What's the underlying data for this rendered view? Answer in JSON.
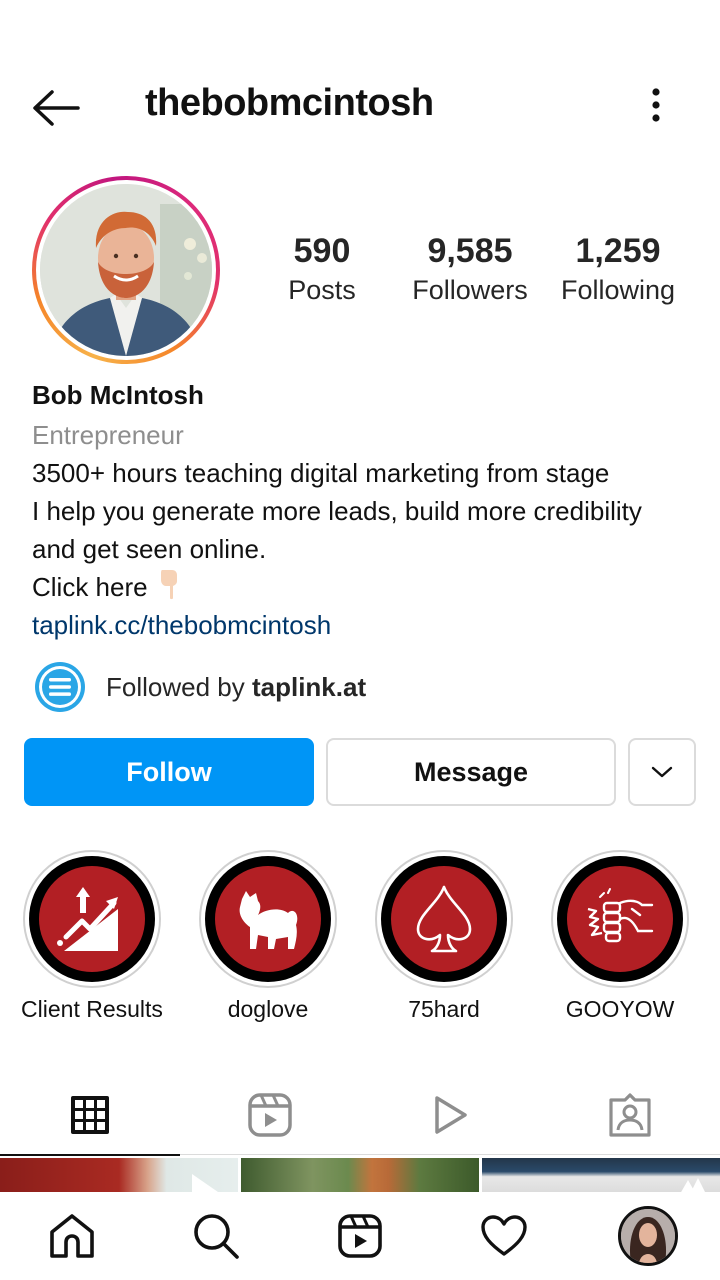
{
  "header": {
    "username": "thebobmcintosh",
    "back_icon": "arrow-left-icon",
    "more_icon": "more-vertical-icon"
  },
  "profile": {
    "avatar_alt": "Profile photo of Bob McIntosh",
    "stats": [
      {
        "value": "590",
        "label": "Posts"
      },
      {
        "value": "9,585",
        "label": "Followers"
      },
      {
        "value": "1,259",
        "label": "Following"
      }
    ],
    "name": "Bob McIntosh",
    "category": "Entrepreneur",
    "bio_lines": [
      "3500+ hours teaching digital marketing from stage",
      "I help you generate more leads, build more credibility",
      "and get seen online.",
      "Click here"
    ],
    "link": "taplink.cc/thebobmcintosh",
    "followed_by_prefix": "Followed by ",
    "followed_by_account": "taplink.at"
  },
  "actions": {
    "follow": "Follow",
    "message": "Message",
    "more_icon": "chevron-down-icon"
  },
  "highlights": [
    {
      "label": "Client Results",
      "icon": "growth-chart-icon"
    },
    {
      "label": "doglove",
      "icon": "dog-icon"
    },
    {
      "label": "75hard",
      "icon": "spade-icon"
    },
    {
      "label": "GOOYOW",
      "icon": "fist-punch-icon"
    }
  ],
  "tabs": [
    {
      "name": "grid",
      "icon": "grid-icon",
      "active": true
    },
    {
      "name": "reels",
      "icon": "reels-icon",
      "active": false
    },
    {
      "name": "videos",
      "icon": "play-icon",
      "active": false
    },
    {
      "name": "tagged",
      "icon": "tagged-person-icon",
      "active": false
    }
  ],
  "bottom_nav": [
    {
      "name": "home",
      "icon": "home-icon"
    },
    {
      "name": "search",
      "icon": "search-icon"
    },
    {
      "name": "reels",
      "icon": "reels-icon"
    },
    {
      "name": "activity",
      "icon": "heart-icon"
    },
    {
      "name": "profile",
      "icon": "profile-avatar"
    }
  ],
  "colors": {
    "follow_blue": "#0095f6",
    "link_blue": "#00376b",
    "highlight_red": "#b21f24",
    "muted_gray": "#8e8e8e"
  }
}
